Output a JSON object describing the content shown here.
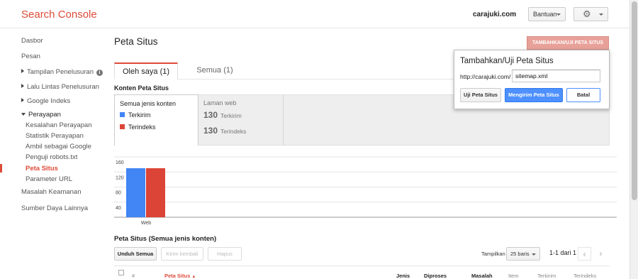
{
  "header": {
    "app_title": "Search Console",
    "site": "carajuki.com",
    "help_label": "Bantuan",
    "settings_icon": "gear-icon"
  },
  "sidebar": {
    "items": [
      {
        "label": "Dasbor"
      },
      {
        "label": "Pesan"
      },
      {
        "label": "Tampilan Penelusuran"
      },
      {
        "label": "Lalu Lintas Penelusuran"
      },
      {
        "label": "Google Indeks"
      },
      {
        "label": "Perayapan"
      },
      {
        "label": "Kesalahan Perayapan"
      },
      {
        "label": "Statistik Perayapan"
      },
      {
        "label": "Ambil sebagai Google"
      },
      {
        "label": "Penguji robots.txt"
      },
      {
        "label": "Peta Situs"
      },
      {
        "label": "Parameter URL"
      },
      {
        "label": "Masalah Keamanan"
      },
      {
        "label": "Sumber Daya Lainnya"
      }
    ]
  },
  "main": {
    "title": "Peta Situs",
    "add_button": "TAMBAHKAN/UJI PETA SITUS",
    "tabs": [
      {
        "label": "Oleh saya (1)"
      },
      {
        "label": "Semua (1)"
      }
    ],
    "content_label": "Konten Peta Situs",
    "type_panel": {
      "title": "Semua jenis konten",
      "legend": [
        {
          "label": "Terkirim",
          "color": "#4285f4"
        },
        {
          "label": "Terindeks",
          "color": "#db4437"
        }
      ]
    },
    "web_panel": {
      "title": "Laman web",
      "rows": [
        {
          "value": "130",
          "label": "Terkirim"
        },
        {
          "value": "130",
          "label": "Terindeks"
        }
      ]
    },
    "section_title": "Peta Situs (Semua jenis konten)",
    "toolbar": {
      "download": "Unduh Semua",
      "resend": "Kirim kembali",
      "delete": "Hapus",
      "show_label": "Tampilkan",
      "rows_value": "25 baris",
      "pager": "1-1 dari 1"
    },
    "columns": [
      "#",
      "Peta Situs",
      "Jenis",
      "Diproses",
      "Masalah",
      "Item",
      "Terkirim",
      "Terindeks"
    ]
  },
  "popup": {
    "title": "Tambahkan/Uji Peta Situs",
    "url_prefix": "http://carajuki.com/",
    "input_value": "sitemap.xml",
    "test_label": "Uji Peta Situs",
    "submit_label": "Mengirim Peta Situs",
    "cancel_label": "Batal"
  },
  "chart_data": {
    "type": "bar",
    "categories": [
      "Web"
    ],
    "series": [
      {
        "name": "Terkirim",
        "values": [
          130
        ],
        "color": "#4285f4"
      },
      {
        "name": "Terindeks",
        "values": [
          130
        ],
        "color": "#db4437"
      }
    ],
    "yticks": [
      40,
      80,
      120,
      160
    ],
    "ylim": [
      0,
      160
    ],
    "grid": true
  }
}
